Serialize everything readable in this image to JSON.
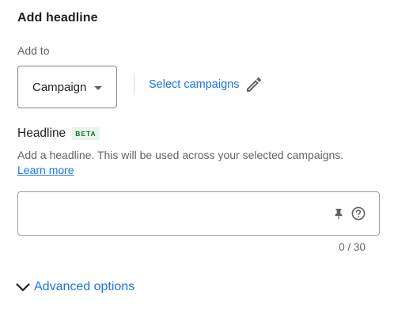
{
  "panel": {
    "title": "Add headline"
  },
  "add_to": {
    "label": "Add to",
    "selected": "Campaign",
    "select_campaigns_label": "Select campaigns"
  },
  "headline": {
    "label": "Headline",
    "badge": "BETA",
    "helper_text": "Add a headline. This will be used across your selected campaigns.",
    "learn_more": "Learn more",
    "value": "",
    "placeholder": "",
    "counter": "0 / 30"
  },
  "advanced": {
    "label": "Advanced options"
  },
  "colors": {
    "link": "#1a73e8",
    "badge_bg": "#e6f4ea",
    "badge_text": "#137333",
    "border": "#80868b"
  },
  "icons": {
    "pencil": "pencil-icon",
    "caret": "caret-down-icon",
    "pin": "pin-icon",
    "help": "help-circle-icon",
    "chevron": "chevron-down-icon"
  }
}
